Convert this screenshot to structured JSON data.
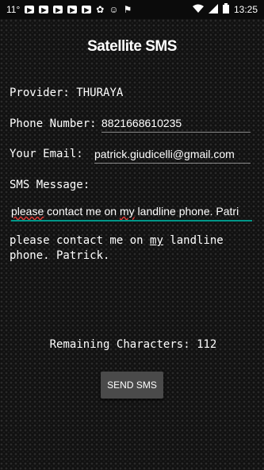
{
  "status_bar": {
    "left_text": "11°",
    "icons": [
      "youtube-icon",
      "youtube-icon",
      "youtube-icon",
      "youtube-icon",
      "youtube-icon",
      "cloud-icon",
      "messenger-icon",
      "flag-icon"
    ],
    "time": "13:25"
  },
  "app": {
    "title": "Satellite SMS"
  },
  "form": {
    "provider_label": "Provider:",
    "provider_value": "THURAYA",
    "phone_label": "Phone Number:",
    "phone_value": "8821668610235",
    "email_label": "Your Email:",
    "email_value": "patrick.giudicelli@gmail.com",
    "sms_label": "SMS Message:",
    "sms_input_parts": {
      "w1": "please",
      "w2": " contact me on ",
      "w3": "my",
      "w4": " landline phone. Patri"
    }
  },
  "preview": {
    "part1": "please contact me on ",
    "part2": "my",
    "part3": " landline phone. Patrick."
  },
  "remaining": {
    "label": "Remaining Characters:",
    "count": "112"
  },
  "send_button": {
    "label": "SEND SMS"
  },
  "colors": {
    "accent": "#009688",
    "spell_error": "#e53935"
  }
}
